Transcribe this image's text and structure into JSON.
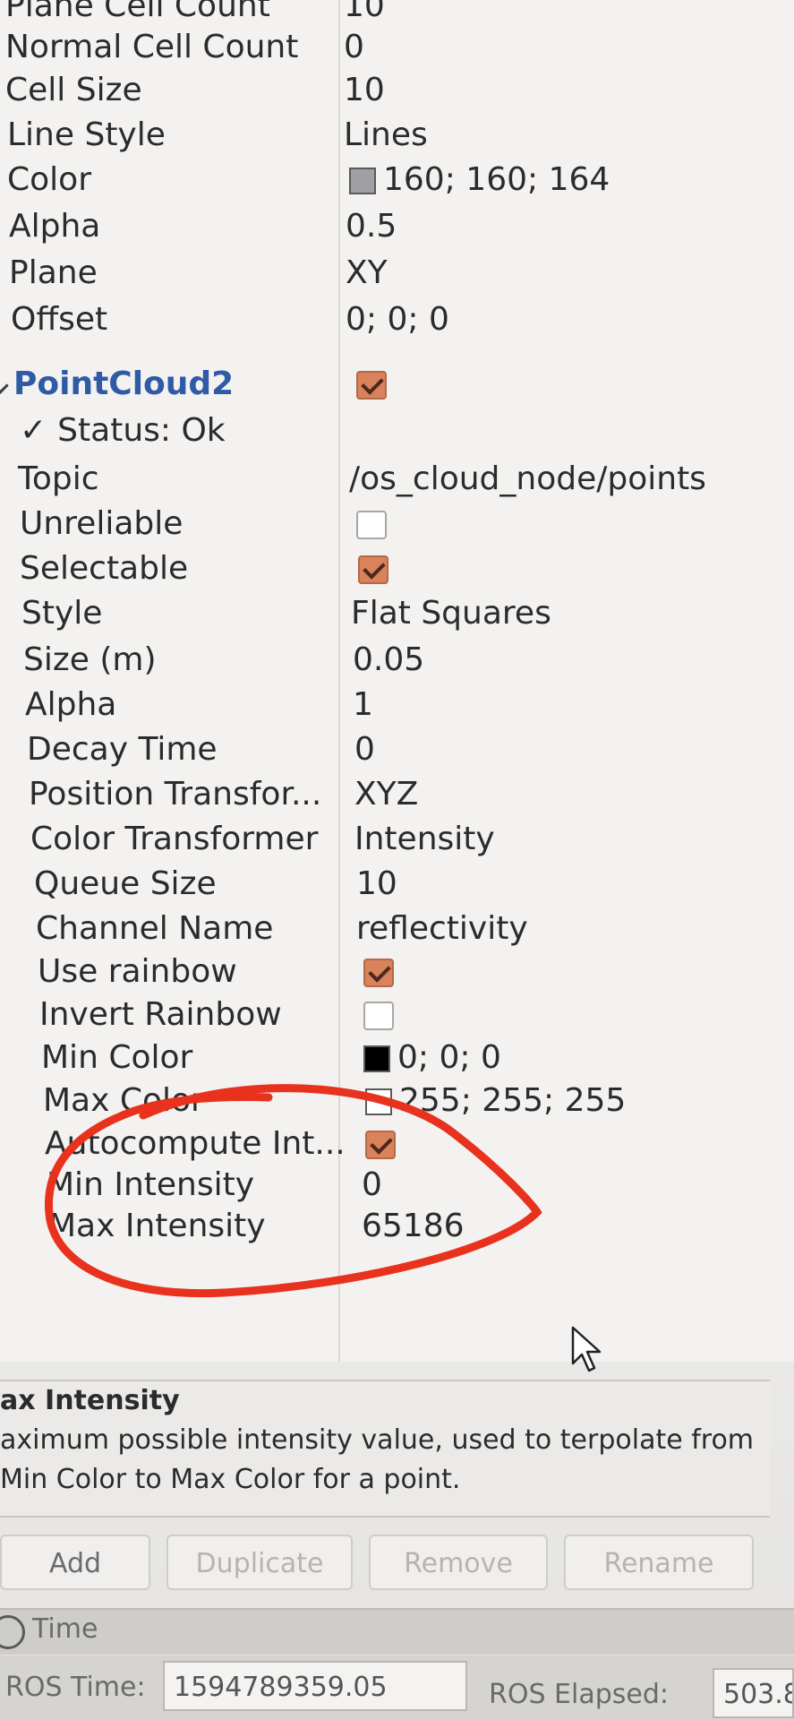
{
  "properties_top": [
    {
      "name": "Plane Cell Count",
      "value": "10"
    },
    {
      "name": "Normal Cell Count",
      "value": "0"
    },
    {
      "name": "Cell Size",
      "value": "10"
    },
    {
      "name": "Line Style",
      "value": "Lines"
    },
    {
      "name": "Color",
      "value": "160; 160; 164",
      "swatch": "#a0a0a4"
    },
    {
      "name": "Alpha",
      "value": "0.5"
    },
    {
      "name": "Plane",
      "value": "XY"
    },
    {
      "name": "Offset",
      "value": "0; 0; 0"
    }
  ],
  "pointcloud": {
    "name": "PointCloud2",
    "enabled": true,
    "status": "Status: Ok",
    "properties": [
      {
        "name": "Topic",
        "value": "/os_cloud_node/points"
      },
      {
        "name": "Unreliable",
        "checkbox": false
      },
      {
        "name": "Selectable",
        "checkbox": true
      },
      {
        "name": "Style",
        "value": "Flat Squares"
      },
      {
        "name": "Size (m)",
        "value": "0.05"
      },
      {
        "name": "Alpha",
        "value": "1"
      },
      {
        "name": "Decay Time",
        "value": "0"
      },
      {
        "name": "Position Transfor...",
        "value": "XYZ"
      },
      {
        "name": "Color Transformer",
        "value": "Intensity"
      },
      {
        "name": "Queue Size",
        "value": "10"
      },
      {
        "name": "Channel Name",
        "value": "reflectivity"
      },
      {
        "name": "Use rainbow",
        "checkbox": true
      },
      {
        "name": "Invert Rainbow",
        "checkbox": false
      },
      {
        "name": "Min Color",
        "value": "0; 0; 0",
        "swatch": "#000000"
      },
      {
        "name": "Max Color",
        "value": "255; 255; 255",
        "swatch": "#ffffff"
      },
      {
        "name": "Autocompute Int...",
        "checkbox": true
      },
      {
        "name": "Min Intensity",
        "value": "0"
      },
      {
        "name": "Max Intensity",
        "value": "65186"
      }
    ]
  },
  "description": {
    "title": "ax Intensity",
    "text": "aximum possible intensity value, used to terpolate from Min Color to Max Color for a point."
  },
  "buttons": [
    {
      "label": "Add",
      "enabled": true
    },
    {
      "label": "Duplicate",
      "enabled": false
    },
    {
      "label": "Remove",
      "enabled": false
    },
    {
      "label": "Rename",
      "enabled": false
    }
  ],
  "time_panel": {
    "title": "Time",
    "ros_time_label": "ROS Time:",
    "ros_time_value": "1594789359.05",
    "ros_elapsed_label": "ROS Elapsed:",
    "ros_elapsed_value": "503.8"
  },
  "colors": {
    "accent_checkbox": "#d9825b",
    "group_text": "#2f5aa6",
    "annotation_red": "#e8321e"
  }
}
